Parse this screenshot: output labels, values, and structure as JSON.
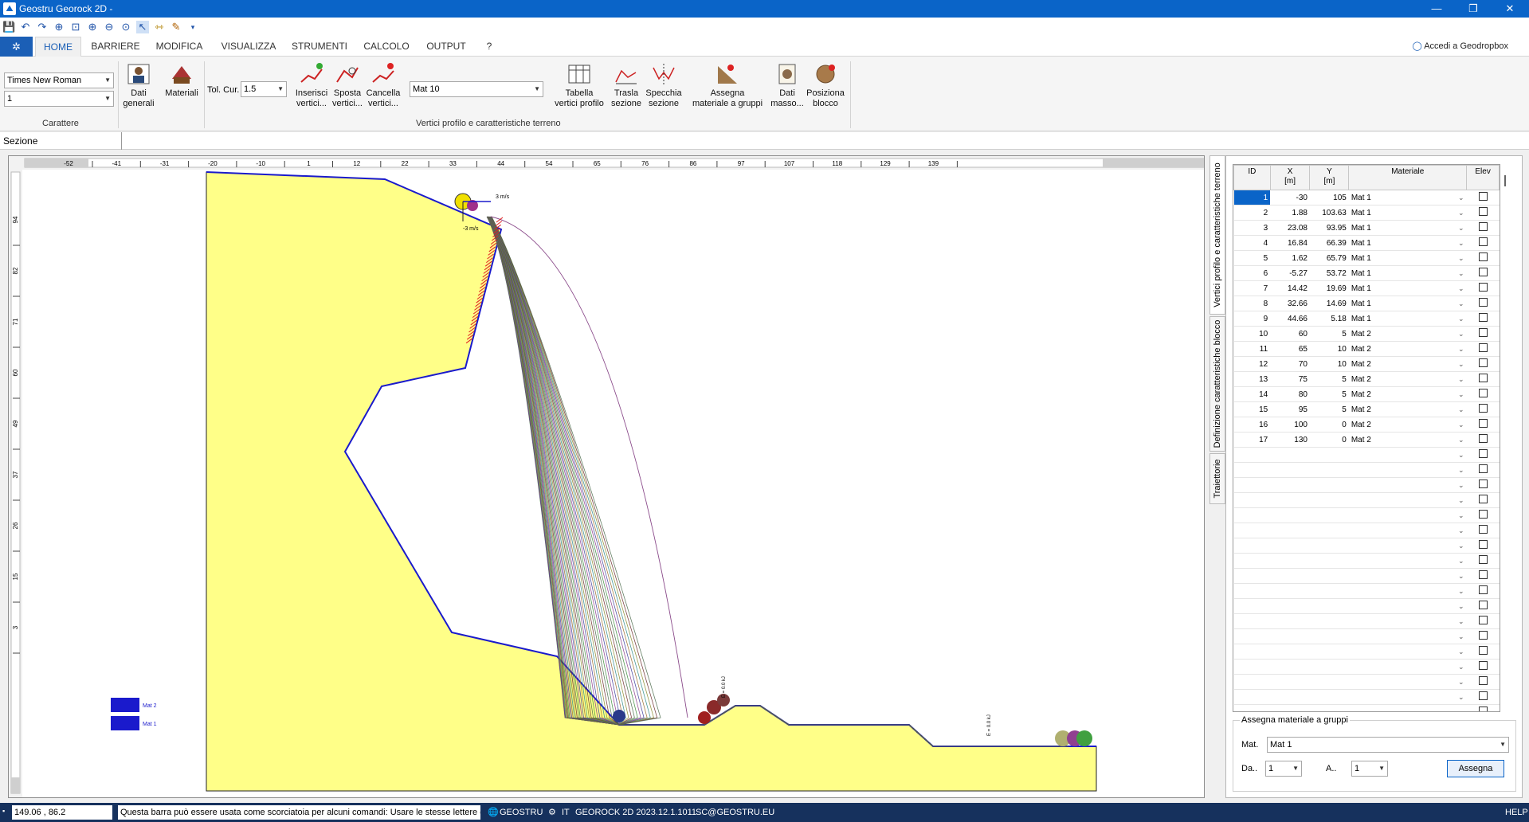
{
  "window": {
    "title": "Geostru Georock 2D -",
    "minimize": "—",
    "maximize": "❐",
    "close": "✕"
  },
  "ribbon_tabs": [
    "HOME",
    "BARRIERE",
    "MODIFICA",
    "VISUALIZZA",
    "STRUMENTI",
    "CALCOLO",
    "OUTPUT",
    "?"
  ],
  "account": "Accedi a Geodropbox",
  "ribbon": {
    "font_name": "Times New Roman",
    "font_size": "1",
    "carattere_label": "Carattere",
    "dati_generali": "Dati generali",
    "materiali": "Materiali",
    "tol_cur_label": "Tol. Cur.",
    "tol_cur_value": "1.5",
    "inserisci": "Inserisci vertici...",
    "sposta": "Sposta vertici...",
    "cancella": "Cancella vertici...",
    "mat_select": "Mat 10",
    "tabella": "Tabella vertici profilo",
    "trasla": "Trasla sezione",
    "specchia": "Specchia sezione",
    "assegna": "Assegna materiale a gruppi",
    "dati_masso": "Dati masso...",
    "posiziona": "Posiziona blocco",
    "vertici_group": "Vertici profilo e caratteristiche terreno"
  },
  "section_label": "Sezione",
  "ruler_x": [
    "-52",
    "-41",
    "-31",
    "-20",
    "-10",
    "1",
    "12",
    "22",
    "33",
    "44",
    "54",
    "65",
    "76",
    "86",
    "97",
    "107",
    "118",
    "129",
    "139"
  ],
  "ruler_y": [
    "94",
    "82",
    "71",
    "60",
    "49",
    "37",
    "26",
    "15",
    "3"
  ],
  "canvas_labels": {
    "velocity_h": "3 m/s",
    "velocity_v": "-3 m/s",
    "energy": "E = 0.0 kJ"
  },
  "legend": [
    {
      "name": "Mat 2",
      "color": "#1a1acc"
    },
    {
      "name": "Mat 1",
      "color": "#1a1acc"
    }
  ],
  "side_tabs": [
    "Vertici profilo e caratteristiche terreno",
    "Definizione caratteristiche blocco",
    "Traiettorie"
  ],
  "table": {
    "headers": {
      "id": "ID",
      "x": "X",
      "x_unit": "[m]",
      "y": "Y",
      "y_unit": "[m]",
      "mat": "Materiale",
      "elev": "Elev"
    },
    "rows": [
      {
        "id": "1",
        "x": "-30",
        "y": "105",
        "mat": "Mat 1"
      },
      {
        "id": "2",
        "x": "1.88",
        "y": "103.63",
        "mat": "Mat 1"
      },
      {
        "id": "3",
        "x": "23.08",
        "y": "93.95",
        "mat": "Mat 1"
      },
      {
        "id": "4",
        "x": "16.84",
        "y": "66.39",
        "mat": "Mat 1"
      },
      {
        "id": "5",
        "x": "1.62",
        "y": "65.79",
        "mat": "Mat 1"
      },
      {
        "id": "6",
        "x": "-5.27",
        "y": "53.72",
        "mat": "Mat 1"
      },
      {
        "id": "7",
        "x": "14.42",
        "y": "19.69",
        "mat": "Mat 1"
      },
      {
        "id": "8",
        "x": "32.66",
        "y": "14.69",
        "mat": "Mat 1"
      },
      {
        "id": "9",
        "x": "44.66",
        "y": "5.18",
        "mat": "Mat 1"
      },
      {
        "id": "10",
        "x": "60",
        "y": "5",
        "mat": "Mat 2"
      },
      {
        "id": "11",
        "x": "65",
        "y": "10",
        "mat": "Mat 2"
      },
      {
        "id": "12",
        "x": "70",
        "y": "10",
        "mat": "Mat 2"
      },
      {
        "id": "13",
        "x": "75",
        "y": "5",
        "mat": "Mat 2"
      },
      {
        "id": "14",
        "x": "80",
        "y": "5",
        "mat": "Mat 2"
      },
      {
        "id": "15",
        "x": "95",
        "y": "5",
        "mat": "Mat 2"
      },
      {
        "id": "16",
        "x": "100",
        "y": "0",
        "mat": "Mat 2"
      },
      {
        "id": "17",
        "x": "130",
        "y": "0",
        "mat": "Mat 2"
      }
    ],
    "empty_rows": 18
  },
  "assign_panel": {
    "title": "Assegna materiale a gruppi",
    "mat_label": "Mat.",
    "mat_value": "Mat 1",
    "da_label": "Da..",
    "da_value": "1",
    "a_label": "A..",
    "a_value": "1",
    "button": "Assegna"
  },
  "status": {
    "coords": "149.06 , 86.2",
    "hint": "Questa barra può essere usata come scorciatoia per alcuni comandi: Usare le stesse lettere dei",
    "geostru": "GEOSTRU",
    "lang": "IT",
    "version": "GEOROCK 2D 2023.12.1.1011",
    "email": "SC@GEOSTRU.EU",
    "help": "HELP"
  },
  "colors": {
    "accent": "#0a64c8",
    "terrain": "#ffff88",
    "profile": "#1a1acc"
  }
}
